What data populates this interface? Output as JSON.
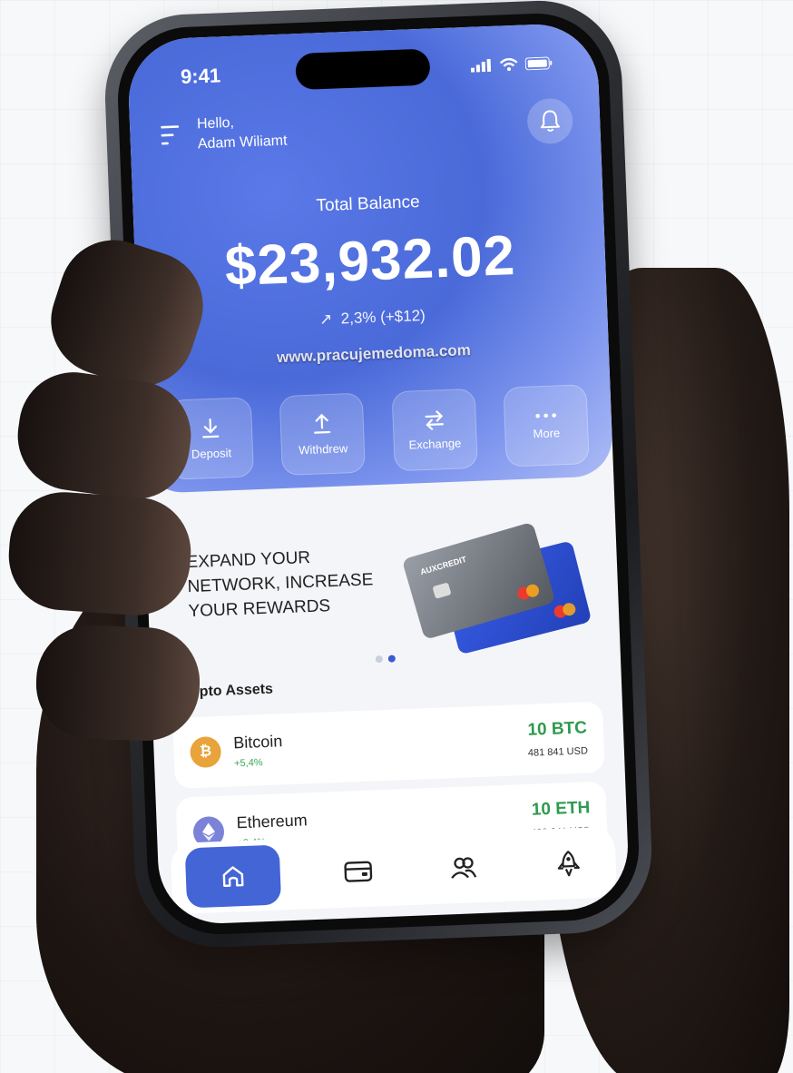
{
  "status_bar": {
    "time": "9:41"
  },
  "header": {
    "greeting_line1": "Hello,",
    "greeting_line2": "Adam Wiliamt"
  },
  "balance": {
    "label": "Total Balance",
    "value": "$23,932.02",
    "change": "2,3% (+$12)"
  },
  "watermark": "www.pracujemedoma.com",
  "actions": [
    {
      "label": "Deposit",
      "icon": "download-icon"
    },
    {
      "label": "Withdrew",
      "icon": "upload-icon"
    },
    {
      "label": "Exchange",
      "icon": "swap-icon"
    },
    {
      "label": "More",
      "icon": "more-icon"
    }
  ],
  "promo": {
    "line1": "EXPAND YOUR",
    "line2": "NETWORK, INCREASE",
    "line3": "YOUR REWARDS",
    "card_brand": "AUXCREDIT",
    "carousel_index": 2,
    "carousel_total": 2
  },
  "crypto_assets": {
    "title": "Crypto Assets",
    "items": [
      {
        "name": "Bitcoin",
        "change": "+5,4%",
        "amount": "10 BTC",
        "usd": "481 841 USD",
        "icon": "bitcoin-icon",
        "color": "#e8a33a"
      },
      {
        "name": "Ethereum",
        "change": "+2,4%",
        "amount": "10 ETH",
        "usd": "488 641 USD",
        "icon": "ethereum-icon",
        "color": "#7b83d8"
      }
    ]
  },
  "bottom_nav": [
    "home-icon",
    "wallet-icon",
    "users-icon",
    "rocket-icon"
  ],
  "colors": {
    "accent": "#4465d6",
    "positive": "#2e9a4e"
  }
}
